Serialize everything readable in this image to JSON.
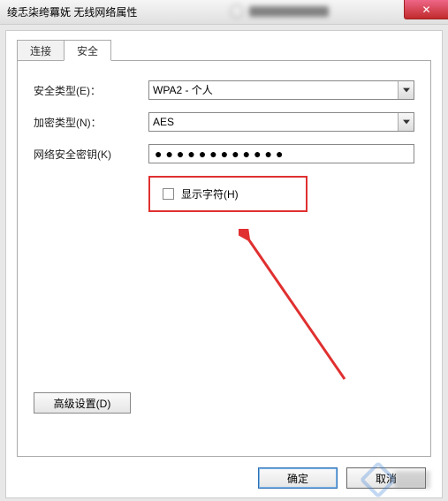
{
  "window": {
    "title": "绫忎柒绔羃妩 无线网络属性",
    "close_glyph": "✕"
  },
  "tabs": {
    "connect": "连接",
    "security": "安全"
  },
  "form": {
    "security_type_label": "安全类型(E)：",
    "security_type_value": "WPA2 - 个人",
    "encryption_label": "加密类型(N)：",
    "encryption_value": "AES",
    "key_label": "网络安全密钥(K)",
    "key_value": "●●●●●●●●●●●●",
    "show_chars_label": "显示字符(H)"
  },
  "buttons": {
    "advanced": "高级设置(D)",
    "ok": "确定",
    "cancel": "取消"
  },
  "annotation": {
    "color": "#e03030"
  }
}
